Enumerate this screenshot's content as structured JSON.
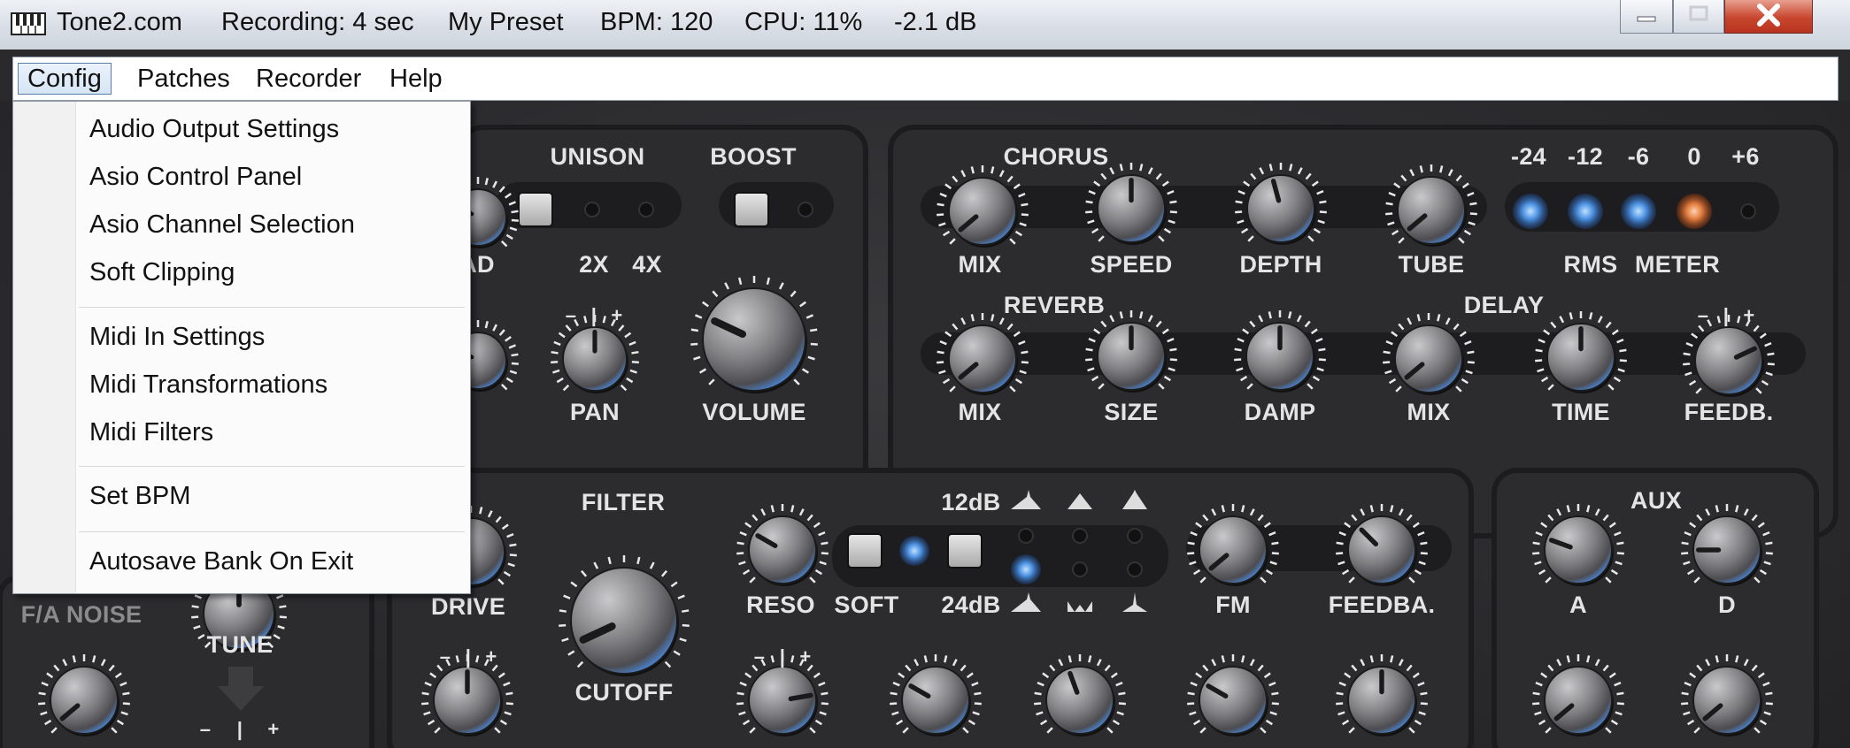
{
  "window": {
    "app_name": "Tone2.com",
    "recording": "Recording: 4 sec",
    "preset": "My Preset",
    "bpm": "BPM: 120",
    "cpu": "CPU: 11%",
    "level": "-2.1 dB",
    "app_icon": "piano-keyboard-icon",
    "controls": [
      "minimize-icon",
      "maximize-icon",
      "close-icon"
    ]
  },
  "menubar": {
    "items": [
      "Config",
      "Patches",
      "Recorder",
      "Help"
    ],
    "active": "Config"
  },
  "config_menu": {
    "items": [
      "Audio Output Settings",
      "Asio Control Panel",
      "Asio Channel Selection",
      "Soft Clipping",
      "Midi In Settings",
      "Midi Transformations",
      "Midi Filters",
      "Set BPM",
      "Autosave Bank On Exit"
    ]
  },
  "synth": {
    "sections": {
      "unison": "UNISON",
      "boost": "BOOST",
      "chorus": "CHORUS",
      "reverb": "REVERB",
      "delay": "DELAY",
      "filter": "FILTER",
      "aux": "AUX"
    },
    "labels": {
      "ad": "AD",
      "x2": "2X",
      "x4": "4X",
      "pan": "PAN",
      "volume": "VOLUME",
      "chorus_mix": "MIX",
      "speed": "SPEED",
      "depth": "DEPTH",
      "tube": "TUBE",
      "rms": "RMS",
      "meter": "METER",
      "reverb_mix": "MIX",
      "size": "SIZE",
      "damp": "DAMP",
      "delay_mix": "MIX",
      "time": "TIME",
      "feedb": "FEEDB.",
      "fa_noise": "F/A NOISE",
      "tune": "TUNE",
      "drive": "DRIVE",
      "cutoff": "CUTOFF",
      "reso": "RESO",
      "soft": "SOFT",
      "db12": "12dB",
      "db24": "24dB",
      "fm": "FM",
      "feedba": "FEEDBA.",
      "aux_a": "A",
      "aux_d": "D",
      "pan_minus": "–",
      "pan_bar": "|",
      "pan_plus": "+"
    },
    "meter_scale": [
      "-24",
      "-12",
      "-6",
      "0",
      "+6"
    ],
    "meter_leds": [
      "blue",
      "blue",
      "blue",
      "orange",
      "off"
    ]
  },
  "colors": {
    "accent_blue": "#4a8fe0",
    "meter_orange": "#e07a3c",
    "panel": "#2f2f32",
    "text": "#e4e4e4"
  }
}
